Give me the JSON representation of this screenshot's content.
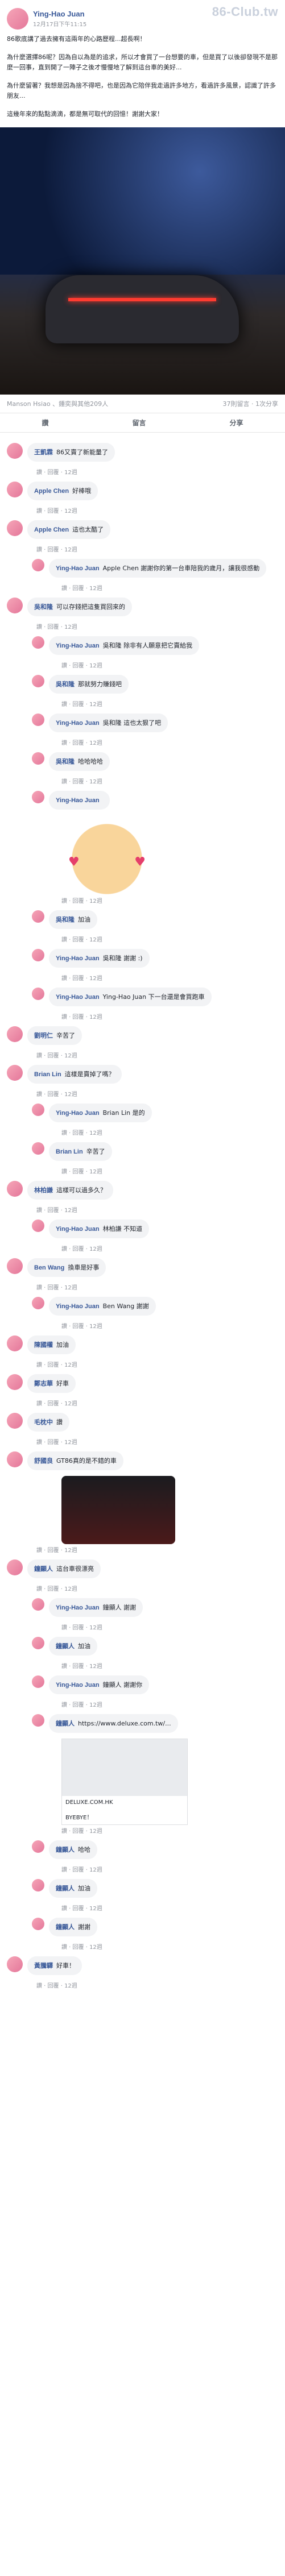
{
  "watermark": "86-Club.tw",
  "post": {
    "author": "Ying-Hao Juan",
    "time": "12月17日下午11:15",
    "paragraphs": [
      "86歌底講了過去擁有這兩年的心路歷程...超長啊！",
      "為什麼選擇86呢？因為自以為是的追求，所以才會買了一台想要的車，但是買了以後卻發現不是那麼一回事，直到開了一陣子之後才慢慢地了解到這台車的美好...",
      "為什麼留著？我想是因為捨不得吧，也是因為它陪伴我走過許多地方，看過許多風景，認識了許多朋友...",
      "這幾年來的點點滴滴，都是無可取代的回憶！謝謝大家！"
    ],
    "reactions_left": "Manson Hsiao 、鍾奕與其他209人",
    "reactions_right": "37則留言 · 1次分享",
    "actions": [
      "讚",
      "留言",
      "分享"
    ]
  },
  "comments": [
    {
      "name": "王凱霖",
      "text": "86又賣了新能量了",
      "sub": "讚 · 回覆 · 12週",
      "reply": false
    },
    {
      "name": "Apple Chen",
      "text": "好棒哦",
      "sub": "讚 · 回覆 · 12週",
      "reply": false
    },
    {
      "name": "Apple Chen",
      "text": "這也太酷了",
      "sub": "讚 · 回覆 · 12週",
      "reply": false
    },
    {
      "name": "Ying-Hao Juan",
      "text": "Apple Chen 謝謝你的第一台車陪我的歲月，讓我很感動",
      "sub": "讚 · 回覆 · 12週",
      "reply": true
    },
    {
      "name": "吳和隆",
      "text": "可以存錢把這隻買回來的",
      "sub": "讚 · 回覆 · 12週",
      "reply": false
    },
    {
      "name": "Ying-Hao Juan",
      "text": "吳和隆 除非有人願意把它賣給我",
      "sub": "讚 · 回覆 · 12週",
      "reply": true
    },
    {
      "name": "吳和隆",
      "text": "那就努力賺錢吧",
      "sub": "讚 · 回覆 · 12週",
      "reply": true
    },
    {
      "name": "Ying-Hao Juan",
      "text": "吳和隆 這也太狠了吧",
      "sub": "讚 · 回覆 · 12週",
      "reply": true
    },
    {
      "name": "吳和隆",
      "text": "哈哈哈哈",
      "sub": "讚 · 回覆 · 12週",
      "reply": true
    },
    {
      "name": "Ying-Hao Juan",
      "text": "",
      "sub": "讚 · 回覆 · 12週",
      "reply": true,
      "sticker": true
    },
    {
      "name": "吳和隆",
      "text": "加油",
      "sub": "讚 · 回覆 · 12週",
      "reply": true
    },
    {
      "name": "Ying-Hao Juan",
      "text": "吳和隆 謝謝 :)",
      "sub": "讚 · 回覆 · 12週",
      "reply": true
    },
    {
      "name": "Ying-Hao Juan",
      "text": "Ying-Hao Juan 下一台還是會買跑車",
      "sub": "讚 · 回覆 · 12週",
      "reply": true
    },
    {
      "name": "劉明仁",
      "text": "辛苦了",
      "sub": "讚 · 回覆 · 12週",
      "reply": false
    },
    {
      "name": "Brian Lin",
      "text": "這樣是賣掉了嗎？",
      "sub": "讚 · 回覆 · 12週",
      "reply": false
    },
    {
      "name": "Ying-Hao Juan",
      "text": "Brian Lin 是的",
      "sub": "讚 · 回覆 · 12週",
      "reply": true
    },
    {
      "name": "Brian Lin",
      "text": "辛苦了",
      "sub": "讚 · 回覆 · 12週",
      "reply": true
    },
    {
      "name": "林柏謙",
      "text": "這樣可以過多久？",
      "sub": "讚 · 回覆 · 12週",
      "reply": false
    },
    {
      "name": "Ying-Hao Juan",
      "text": "林柏謙 不知道",
      "sub": "讚 · 回覆 · 12週",
      "reply": true
    },
    {
      "name": "Ben Wang",
      "text": "換車是好事",
      "sub": "讚 · 回覆 · 12週",
      "reply": false
    },
    {
      "name": "Ying-Hao Juan",
      "text": "Ben Wang 謝謝",
      "sub": "讚 · 回覆 · 12週",
      "reply": true
    },
    {
      "name": "陳國權",
      "text": "加油",
      "sub": "讚 · 回覆 · 12週",
      "reply": false
    },
    {
      "name": "鄭志華",
      "text": "好車",
      "sub": "讚 · 回覆 · 12週",
      "reply": false
    },
    {
      "name": "毛枕中",
      "text": "讚",
      "sub": "讚 · 回覆 · 12週",
      "reply": false
    },
    {
      "name": "舒國良",
      "text": "GT86真的是不錯的車",
      "sub": "讚 · 回覆 · 12週",
      "reply": false,
      "carimg": true
    },
    {
      "name": "鐘顯人",
      "text": "這台車很漂亮",
      "sub": "讚 · 回覆 · 12週",
      "reply": false
    },
    {
      "name": "Ying-Hao Juan",
      "text": "鐘顯人 謝謝",
      "sub": "讚 · 回覆 · 12週",
      "reply": true
    },
    {
      "name": "鐘顯人",
      "text": "加油",
      "sub": "讚 · 回覆 · 12週",
      "reply": true
    },
    {
      "name": "Ying-Hao Juan",
      "text": "鐘顯人 謝謝你",
      "sub": "讚 · 回覆 · 12週",
      "reply": true
    },
    {
      "name": "鐘顯人",
      "text": "https://www.deluxe.com.tw/...",
      "sub": "讚 · 回覆 · 12週",
      "reply": true,
      "linkcard": true,
      "link_domain": "DELUXE.COM.HK",
      "link_title": "BYEBYE！"
    },
    {
      "name": "鐘顯人",
      "text": "哈哈",
      "sub": "讚 · 回覆 · 12週",
      "reply": true
    },
    {
      "name": "鐘顯人",
      "text": "加油",
      "sub": "讚 · 回覆 · 12週",
      "reply": true
    },
    {
      "name": "鐘顯人",
      "text": "謝謝",
      "sub": "讚 · 回覆 · 12週",
      "reply": true
    },
    {
      "name": "黃騰驛",
      "text": "好車！",
      "sub": "讚 · 回覆 · 12週",
      "reply": false
    }
  ]
}
